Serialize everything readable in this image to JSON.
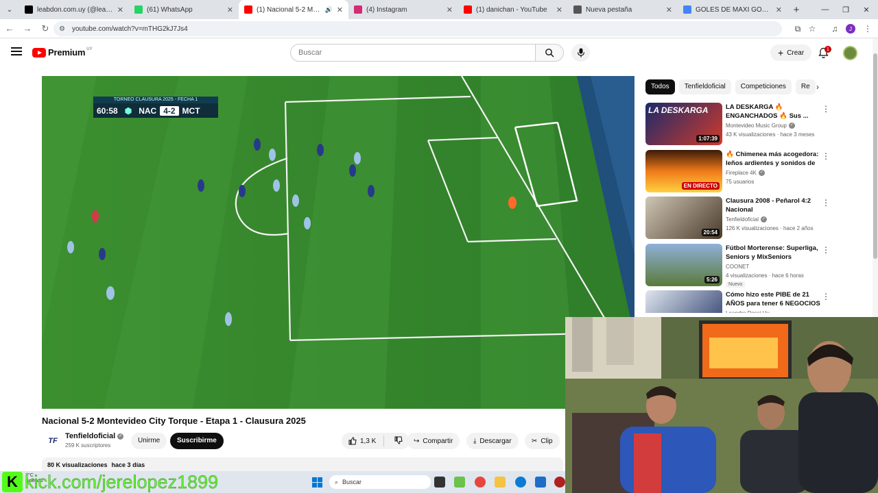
{
  "browser": {
    "tabs": [
      {
        "label": "leabdon.com.uy (@leabdon) / X",
        "icon": "x-icon",
        "color": "#000000",
        "active": false
      },
      {
        "label": "(61) WhatsApp",
        "icon": "whatsapp-icon",
        "color": "#25d366",
        "active": false
      },
      {
        "label": "(1) Nacional 5-2 Montevideo",
        "icon": "youtube-icon",
        "color": "#ff0000",
        "active": true
      },
      {
        "label": "(4) Instagram",
        "icon": "instagram-icon",
        "color": "#d62976",
        "active": false
      },
      {
        "label": "(1) danichan - YouTube",
        "icon": "youtube-icon",
        "color": "#ff0000",
        "active": false
      },
      {
        "label": "Nueva pestaña",
        "icon": "chrome-icon",
        "color": "#555555",
        "active": false
      },
      {
        "label": "GOLES DE MAXI GÓMEZ - Busc",
        "icon": "google-icon",
        "color": "#4285f4",
        "active": false
      }
    ],
    "url": "youtube.com/watch?v=mTHG2kJ7Js4"
  },
  "youtube": {
    "logo_text": "Premium",
    "country": "UY",
    "search_placeholder": "Buscar",
    "create_label": "Crear",
    "notification_count": "1"
  },
  "video": {
    "title": "Nacional 5-2 Montevideo City Torque - Etapa 1 - Clausura 2025",
    "scorebug": {
      "tournament": "TORNEO CLAUSURA 2025 - FECHA 1",
      "time": "60:58",
      "home": "NAC",
      "score": "4-2",
      "away": "MCT"
    },
    "channel": {
      "name": "Tenfieldoficial",
      "subscribers": "259 K suscriptores",
      "logo_text": "TF"
    },
    "join_label": "Unirme",
    "subscribe_label": "Suscribirme",
    "likes": "1,3 K",
    "share_label": "Compartir",
    "download_label": "Descargar",
    "clip_label": "Clip",
    "views": "80 K visualizaciones",
    "published": "hace 3 días"
  },
  "chips": [
    "Todos",
    "Tenfieldoficial",
    "Competiciones",
    "Re"
  ],
  "recommendations": [
    {
      "title": "LA DESKARGA 🔥 ENGANCHADOS 🔥 Sus ...",
      "channel": "Montevideo Music Group",
      "verified": true,
      "meta": "43 K visualizaciones · hace 3 meses",
      "duration": "1:07:39",
      "thumb_text": "LA DESKARGA",
      "live": false,
      "new": false
    },
    {
      "title": "🔥 Chimenea más acogedora: leños ardientes y sonidos de ...",
      "channel": "Fireplace 4K",
      "verified": true,
      "meta": "75 usuarios",
      "duration": "EN DIRECTO",
      "thumb_text": "",
      "live": true,
      "new": false
    },
    {
      "title": "Clausura 2008 - Peñarol 4:2 Nacional",
      "channel": "Tenfieldoficial",
      "verified": true,
      "meta": "126 K visualizaciones · hace 2 años",
      "duration": "20:54",
      "thumb_text": "",
      "live": false,
      "new": false
    },
    {
      "title": "Fútbol Morterense: Superliga, Seniors y MixSeniors",
      "channel": "COONET",
      "verified": false,
      "meta": "4 visualizaciones · hace 6 horas",
      "duration": "5:26",
      "thumb_text": "",
      "live": false,
      "new": true,
      "new_label": "Nuevo"
    },
    {
      "title": "Cómo hizo este PIBE de 21 AÑOS para tener 6 NEGOCIOS ...",
      "channel": "Leandro Rossi Uy",
      "verified": false,
      "meta": "",
      "duration": "",
      "thumb_text": "",
      "live": false,
      "new": false
    }
  ],
  "overlay": {
    "kick_logo": "K",
    "kick_status": "Soleado",
    "kick_temp": "7°C",
    "kick_url": "kick.com/jerelopez1899"
  },
  "taskbar": {
    "search_label": "Buscar"
  }
}
